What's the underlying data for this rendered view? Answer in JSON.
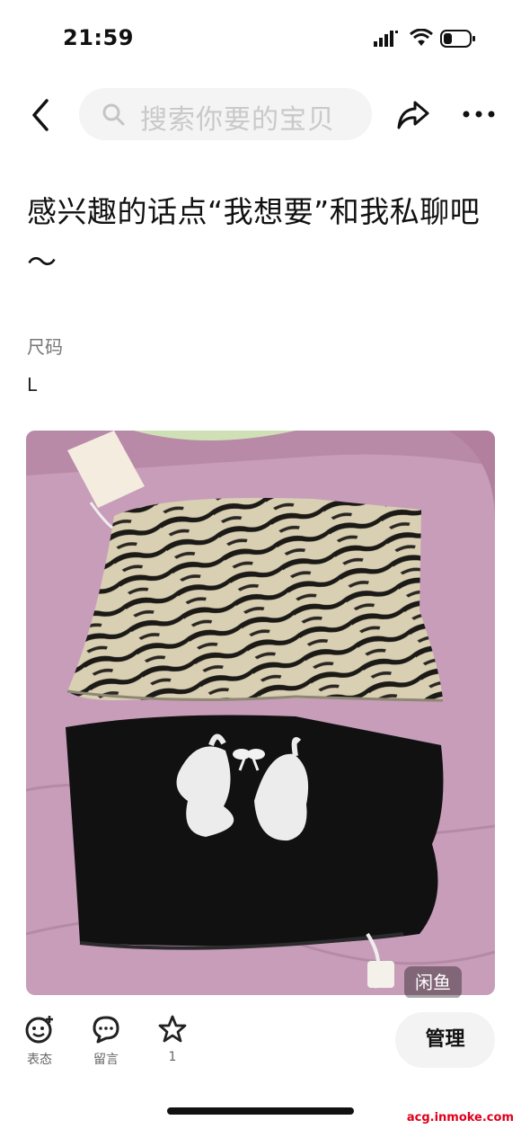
{
  "status": {
    "time": "21:59"
  },
  "search": {
    "placeholder": "搜索你要的宝贝"
  },
  "item": {
    "description": "感兴趣的话点“我想要”和我私聊吧～",
    "attr_label": "尺码",
    "attr_value": "L"
  },
  "photo": {
    "watermark": "闲鱼"
  },
  "actions": {
    "react_label": "表态",
    "comment_label": "留言",
    "favorite_count": "1",
    "manage_label": "管理"
  },
  "footer": {
    "site": "acg.inmoke.com"
  }
}
